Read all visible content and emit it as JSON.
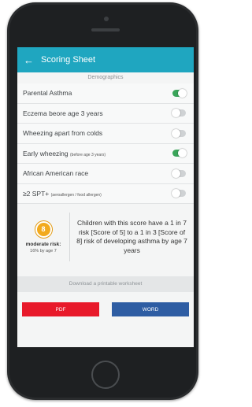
{
  "appbar": {
    "back_icon": "←",
    "title": "Scoring Sheet"
  },
  "section_title": "Demographics",
  "toggles": [
    {
      "label": "Parental Asthma",
      "note": "",
      "on": true
    },
    {
      "label": "Eczema beore age 3 years",
      "note": "",
      "on": false
    },
    {
      "label": "Wheezing apart from colds",
      "note": "",
      "on": false
    },
    {
      "label": "Early wheezing",
      "note": "(before age 3 years)",
      "on": true
    },
    {
      "label": "African American race",
      "note": "",
      "on": false
    },
    {
      "label": "≥2 SPT+",
      "note": "(aeroallergen / food allergen)",
      "on": false
    }
  ],
  "risk": {
    "score": "8",
    "level": "moderate risk:",
    "percent": "16% by age 7",
    "description": "Children with this score have a 1 in 7 risk [Score of 5] to a 1 in 3 [Score of 8] risk of developing asthma by age 7 years"
  },
  "download_label": "Download a printable worksheet",
  "buttons": {
    "pdf": "PDF",
    "word": "WORD"
  },
  "colors": {
    "appbar": "#1fa6c0",
    "toggle_on": "#3aa55a",
    "pdf_button": "#e8192a",
    "word_button": "#2e5da3",
    "risk_badge": "#f2aa1e"
  }
}
